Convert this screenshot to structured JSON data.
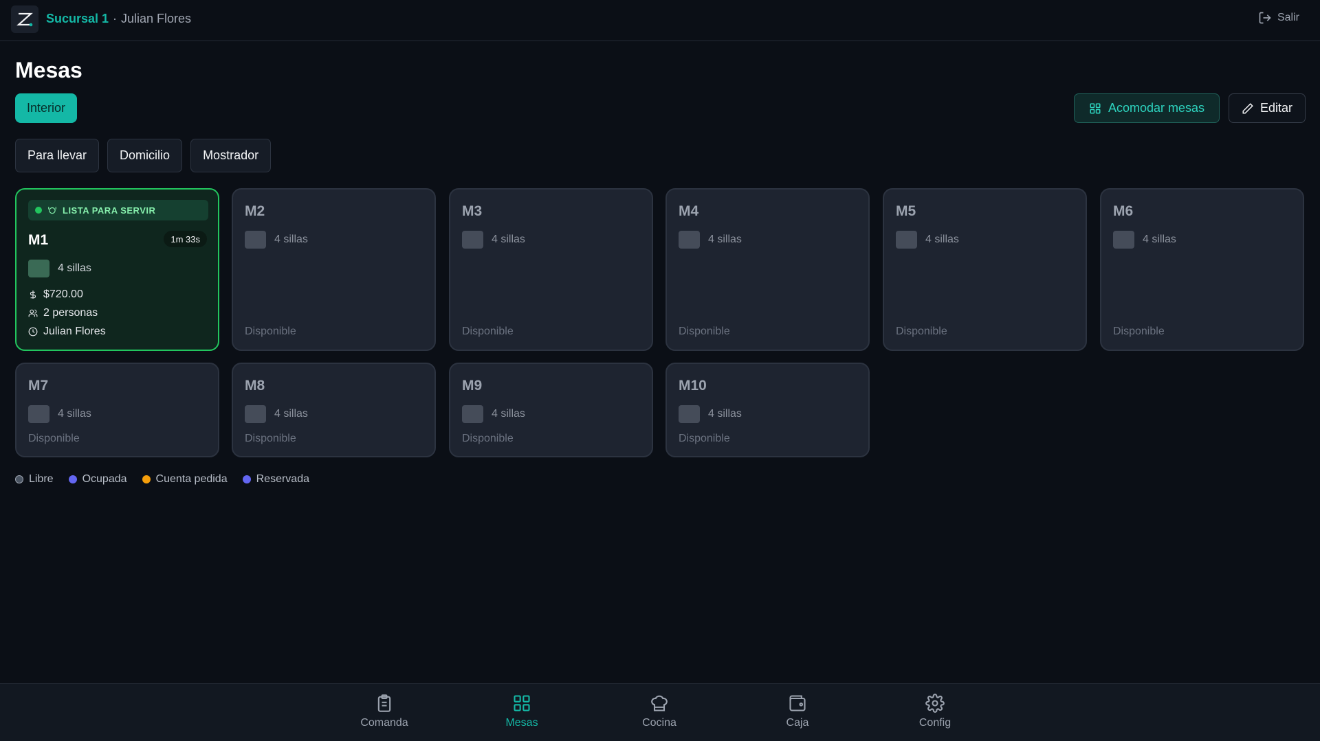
{
  "header": {
    "branch": "Sucursal 1",
    "separator": "·",
    "user": "Julian Flores",
    "logout_label": "Salir"
  },
  "page": {
    "title": "Mesas"
  },
  "zones": [
    {
      "label": "Interior",
      "active": true
    }
  ],
  "actions": {
    "arrange_label": "Acomodar mesas",
    "edit_label": "Editar"
  },
  "modes": [
    {
      "label": "Para llevar"
    },
    {
      "label": "Domicilio"
    },
    {
      "label": "Mostrador"
    }
  ],
  "tables": [
    {
      "name": "M1",
      "chairs": "4 sillas",
      "banner": "LISTA PARA SERVIR",
      "timer": "1m 33s",
      "total": "$720.00",
      "people": "2 personas",
      "waiter": "Julian Flores"
    },
    {
      "name": "M2",
      "chairs": "4 sillas",
      "status": "Disponible"
    },
    {
      "name": "M3",
      "chairs": "4 sillas",
      "status": "Disponible"
    },
    {
      "name": "M4",
      "chairs": "4 sillas",
      "status": "Disponible"
    },
    {
      "name": "M5",
      "chairs": "4 sillas",
      "status": "Disponible"
    },
    {
      "name": "M6",
      "chairs": "4 sillas",
      "status": "Disponible"
    },
    {
      "name": "M7",
      "chairs": "4 sillas",
      "status": "Disponible"
    },
    {
      "name": "M8",
      "chairs": "4 sillas",
      "status": "Disponible"
    },
    {
      "name": "M9",
      "chairs": "4 sillas",
      "status": "Disponible"
    },
    {
      "name": "M10",
      "chairs": "4 sillas",
      "status": "Disponible"
    }
  ],
  "legend": [
    {
      "label": "Libre",
      "color": "#4b5563"
    },
    {
      "label": "Ocupada",
      "color": "#6366f1"
    },
    {
      "label": "Cuenta pedida",
      "color": "#f59e0b"
    },
    {
      "label": "Reservada",
      "color": "#6366f1"
    }
  ],
  "nav": [
    {
      "label": "Comanda",
      "icon": "clipboard-icon"
    },
    {
      "label": "Mesas",
      "icon": "grid-icon",
      "active": true
    },
    {
      "label": "Cocina",
      "icon": "chef-hat-icon"
    },
    {
      "label": "Caja",
      "icon": "wallet-icon"
    },
    {
      "label": "Config",
      "icon": "gear-icon"
    }
  ],
  "colors": {
    "accent": "#14b8a6",
    "ready": "#22c55e"
  }
}
